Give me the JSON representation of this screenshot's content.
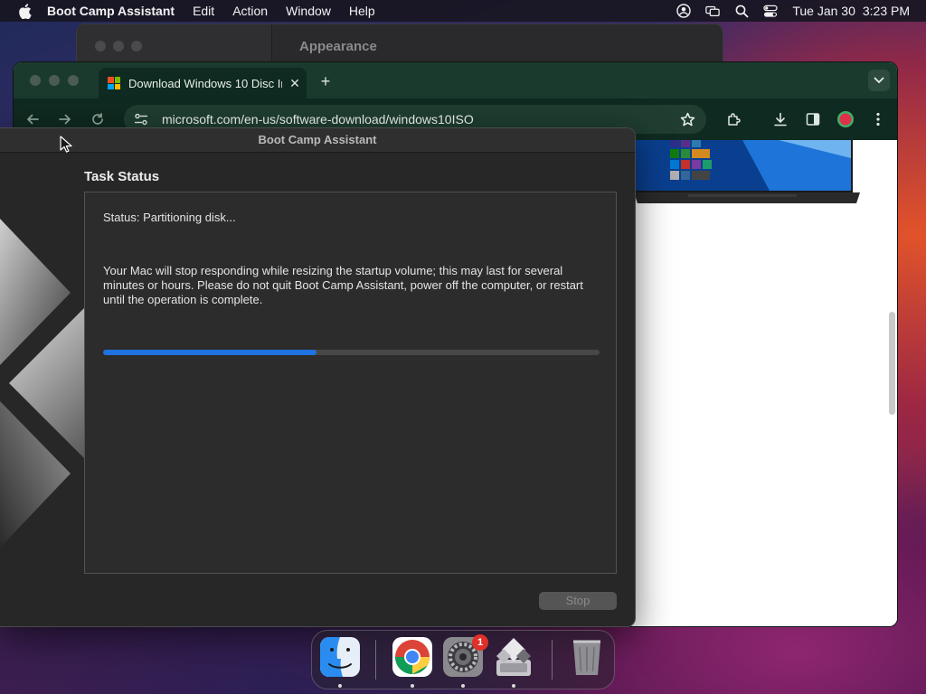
{
  "menubar": {
    "app_name": "Boot Camp Assistant",
    "items": [
      "Edit",
      "Action",
      "Window",
      "Help"
    ],
    "date": "Tue Jan 30",
    "time": "3:23 PM"
  },
  "background_window": {
    "title": "Appearance"
  },
  "browser": {
    "tab_title": "Download Windows 10 Disc Im",
    "url": "microsoft.com/en-us/software-download/windows10ISO",
    "accent_color": "#0f2a20"
  },
  "bootcamp": {
    "window_title": "Boot Camp Assistant",
    "section_title": "Task Status",
    "status": "Status: Partitioning disk...",
    "warning": "Your Mac will stop responding while resizing the startup volume; this may last for several minutes or hours. Please do not quit Boot Camp Assistant, power off the computer, or restart until the operation is complete.",
    "progress_percent": 43,
    "stop_label": "Stop",
    "progress_color": "#1f73e0"
  },
  "dock": {
    "apps": [
      "finder-icon",
      "chrome-icon",
      "system-settings-icon",
      "boot-camp-icon",
      "trash-icon"
    ],
    "settings_badge": "1"
  }
}
